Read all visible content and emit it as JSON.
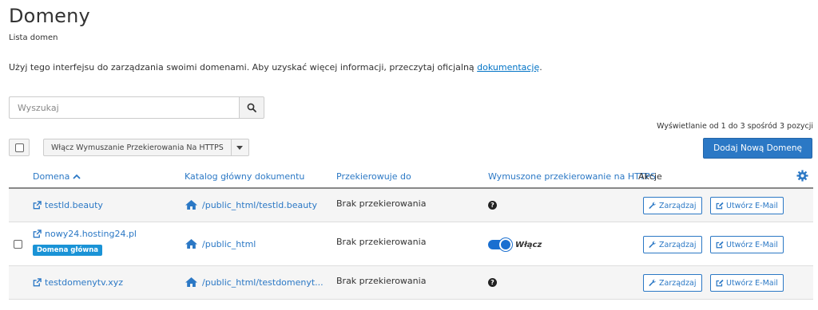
{
  "page": {
    "title": "Domeny",
    "subtitle": "Lista domen",
    "intro_text": "Użyj tego interfejsu do zarządzania swoimi domenami. Aby uzyskać więcej informacji, przeczytaj oficjalną ",
    "intro_link": "dokumentację",
    "intro_end": "."
  },
  "search": {
    "placeholder": "Wyszukaj",
    "icon": "search-icon"
  },
  "pagination_info": "Wyświetlanie od 1 do 3 spośród 3 pozycji",
  "toolbar": {
    "bulk_action_label": "Włącz Wymuszanie Przekierowania Na HTTPS",
    "add_button_label": "Dodaj Nową Domenę"
  },
  "table": {
    "columns": {
      "domain": "Domena",
      "docroot": "Katalog główny dokumentu",
      "redirect": "Przekierowuje do",
      "https": "Wymuszone przekierowanie na HTTPS",
      "actions": "Akcje"
    },
    "rows": [
      {
        "domain": "testld.beauty",
        "docroot": "/public_html/testld.beauty",
        "redirect": "Brak przekierowania",
        "https_state": "unknown",
        "manage_label": "Zarządzaj",
        "email_label": "Utwórz E-Mail"
      },
      {
        "domain": "nowy24.hosting24.pl",
        "badge": "Domena główna",
        "docroot": "/public_html",
        "redirect": "Brak przekierowania",
        "https_state": "on",
        "toggle_label": "Włącz",
        "manage_label": "Zarządzaj",
        "email_label": "Utwórz E-Mail"
      },
      {
        "domain": "testdomenytv.xyz",
        "docroot": "/public_html/testdomenyt...",
        "redirect": "Brak przekierowania",
        "https_state": "unknown",
        "manage_label": "Zarządzaj",
        "email_label": "Utwórz E-Mail"
      }
    ]
  },
  "colors": {
    "accent": "#2b78c5",
    "badge": "#1a93d6",
    "toggle": "#1a6fd0"
  }
}
